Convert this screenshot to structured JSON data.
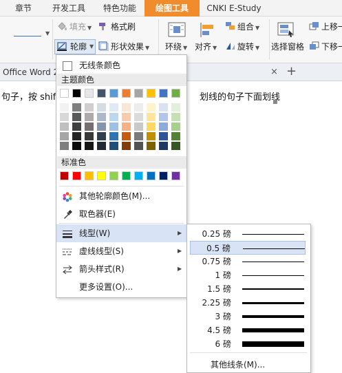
{
  "tabs": [
    {
      "label": "章节",
      "active": false
    },
    {
      "label": "开发工具",
      "active": false
    },
    {
      "label": "特色功能",
      "active": false
    },
    {
      "label": "绘图工具",
      "active": true
    },
    {
      "label": "CNKI E-Study",
      "active": false
    }
  ],
  "ribbon": {
    "fill_label": "填充",
    "format_brush_label": "格式刷",
    "outline_label": "轮廓",
    "shape_effect_label": "形状效果",
    "wrap_label": "环绕",
    "align_label": "对齐",
    "group_label": "组合",
    "rotate_label": "旋转",
    "selection_pane_label": "选择窗格",
    "move_up_label": "上移一",
    "move_down_label": "下移一"
  },
  "document": {
    "tab_title": "Office Word 2",
    "close_symbol": "×",
    "plus_symbol": "+",
    "line_left": "句子，按 shift",
    "line_right": "划线的句子下面划线"
  },
  "outline_menu": {
    "no_line_color": "无线条颜色",
    "theme_colors_label": "主题颜色",
    "standard_colors_label": "标准色",
    "more_colors": "其他轮廓颜色(M)...",
    "eyedropper": "取色器(E)",
    "line_type": "线型(W)",
    "dash_type": "虚线线型(S)",
    "arrow_style": "箭头样式(R)",
    "more_settings": "更多设置(O)...",
    "theme_top_row": [
      "#ffffff",
      "#000000",
      "#e7e6e6",
      "#44546a",
      "#5b9bd5",
      "#ed7d31",
      "#a5a5a5",
      "#ffc000",
      "#4472c4",
      "#70ad47"
    ],
    "theme_shades": [
      [
        "#f2f2f2",
        "#7f7f7f",
        "#d0cece",
        "#d6dce4",
        "#deebf6",
        "#fbe5d5",
        "#ededed",
        "#fff2cc",
        "#d9e2f3",
        "#e2efd9"
      ],
      [
        "#d8d8d8",
        "#595959",
        "#aeaaaa",
        "#adb9ca",
        "#bdd7ee",
        "#f7cbac",
        "#dbdbdb",
        "#fee599",
        "#b4c6e7",
        "#c5e0b3"
      ],
      [
        "#bfbfbf",
        "#3f3f3f",
        "#757070",
        "#8496b0",
        "#9cc3e5",
        "#f4b183",
        "#c9c9c9",
        "#ffd965",
        "#8eaadb",
        "#a8d08d"
      ],
      [
        "#a5a5a5",
        "#262626",
        "#3a3838",
        "#323f4f",
        "#2e75b5",
        "#c55a11",
        "#7b7b7b",
        "#bf9000",
        "#2f5496",
        "#538135"
      ],
      [
        "#7f7f7f",
        "#0c0c0c",
        "#171616",
        "#222a35",
        "#1e4e79",
        "#833c0b",
        "#525252",
        "#7f6000",
        "#1f3864",
        "#375623"
      ]
    ],
    "standard_colors": [
      "#c00000",
      "#ff0000",
      "#ffc000",
      "#ffff00",
      "#92d050",
      "#00b050",
      "#00b0f0",
      "#0070c0",
      "#002060",
      "#7030a0"
    ]
  },
  "line_weight_menu": {
    "items": [
      {
        "label": "0.25 磅",
        "weight": 0.25
      },
      {
        "label": "0.5 磅",
        "weight": 0.5,
        "selected": true
      },
      {
        "label": "0.75 磅",
        "weight": 0.75
      },
      {
        "label": "1 磅",
        "weight": 1
      },
      {
        "label": "1.5 磅",
        "weight": 1.5
      },
      {
        "label": "2.25 磅",
        "weight": 2.25
      },
      {
        "label": "3 磅",
        "weight": 3
      },
      {
        "label": "4.5 磅",
        "weight": 4.5
      },
      {
        "label": "6 磅",
        "weight": 6
      }
    ],
    "more_lines": "其他线条(M)..."
  },
  "colors": {
    "accent_tab": "#f08c2c",
    "highlight": "#d8e4f5"
  }
}
